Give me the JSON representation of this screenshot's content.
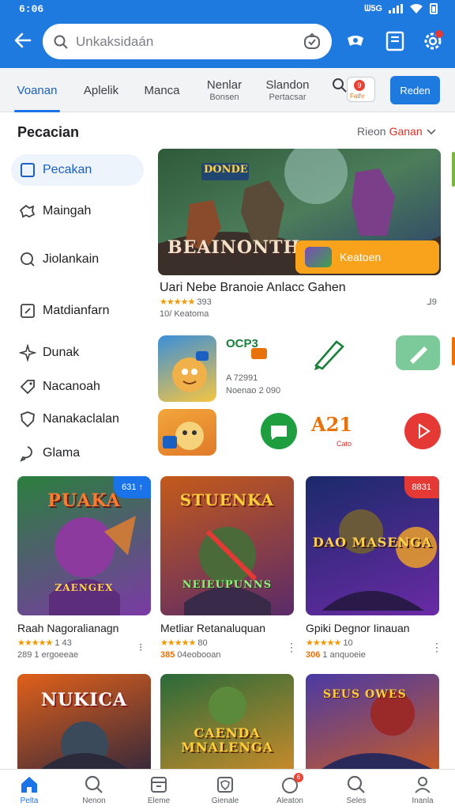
{
  "status_bar": {
    "time": "6:06",
    "network_label": "ᗯ5G"
  },
  "header": {
    "search_placeholder": "Unkaksidaán"
  },
  "tabs": [
    {
      "label": "Voanan",
      "sub": ""
    },
    {
      "label": "Aplelik",
      "sub": ""
    },
    {
      "label": "Manca",
      "sub": ""
    },
    {
      "label": "Nenlar",
      "sub": "Bonsen"
    },
    {
      "label": "Slandon",
      "sub": "Pertacsar"
    }
  ],
  "tab_bar": {
    "notif_count": "9",
    "notif_label": "Fathr",
    "action_label": "Reden"
  },
  "sidebar": {
    "title": "Pecacian",
    "items": [
      {
        "label": "Pecakan"
      },
      {
        "label": "Maingah"
      },
      {
        "label": "Jiolankain"
      },
      {
        "label": "Matdianfarn"
      },
      {
        "label": "Dunak"
      },
      {
        "label": "Nacanoah"
      },
      {
        "label": "Nanakaclalan"
      },
      {
        "label": "Glama"
      }
    ]
  },
  "filter": {
    "label": "Rieon",
    "value": "Ganan"
  },
  "featured": {
    "art_title": "BEAINONTH",
    "art_logo": "DONDE",
    "cta_label": "Keatoen",
    "title": "Uari Nebe Branoie Anlacc Gahen",
    "stars": "★★★★★",
    "rating": "393",
    "subtitle": "10/ Keatoma",
    "more": "ᒧ9"
  },
  "middle": {
    "label_top": "OCP3",
    "label_a": "A 72991",
    "label_b": "Noenao 2 090",
    "icon_text_1": "A21",
    "icon_text_2": "Cato"
  },
  "cards": [
    {
      "art": "PUAKA",
      "art_sub": "ZAENGEX",
      "badge": "631 ↑",
      "badge_color": "#1a73e8",
      "title": "Raah Nagoralianagn",
      "stars": "★★★★★",
      "rating": "1 43",
      "sub_hl": "",
      "sub": "289 1 ergoeeae",
      "more": "⁝"
    },
    {
      "art": "STUENKA",
      "art_sub": "NEIEUPUNNS",
      "badge": "",
      "badge_color": "",
      "title": "Metliar Retanaluquan",
      "stars": "★★★★★",
      "rating": "80",
      "sub_hl": "385",
      "sub": "04eobooan",
      "more": "⋮"
    },
    {
      "art": "DAO MASENGA",
      "art_sub": "",
      "badge": "8831",
      "badge_color": "#e53935",
      "title": "Gpiki Degnor Iinauan",
      "stars": "★★★★★",
      "rating": "10",
      "sub_hl": "306",
      "sub": "1 anquoeie",
      "more": "⋮"
    }
  ],
  "cards_row2": [
    {
      "art": "NUKICA"
    },
    {
      "art": "CAENDA MNALENGA"
    },
    {
      "art": "SEUS OWES"
    }
  ],
  "bottom_nav": [
    {
      "label": "Pelta"
    },
    {
      "label": "Nenon"
    },
    {
      "label": "Eleme"
    },
    {
      "label": "Gienale"
    },
    {
      "label": "Aleaton",
      "badge": "6"
    },
    {
      "label": "Seles"
    },
    {
      "label": "Inanla"
    }
  ],
  "colors": {
    "primary": "#1f7ae0",
    "accent_orange": "#f9a21b",
    "star": "#f29900",
    "badge_red": "#e53935"
  }
}
